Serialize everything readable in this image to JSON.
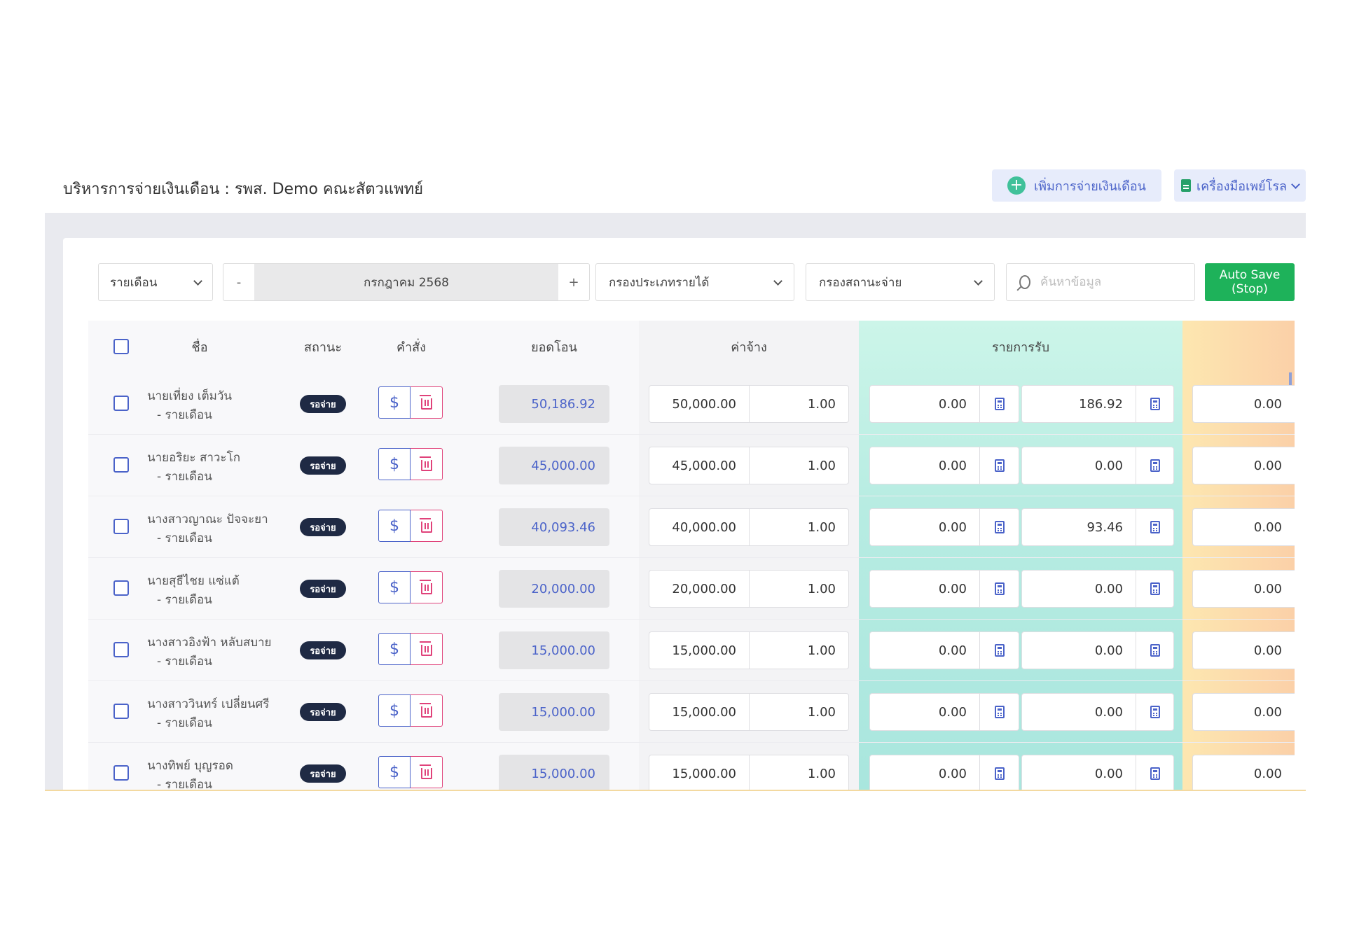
{
  "header": {
    "title": "บริหารการจ่ายเงินเดือน : รพส. Demo คณะสัตวแพทย์",
    "add_button": "เพิ่มการจ่ายเงินเดือน",
    "tools_button": "เครื่องมือเพย์โรล"
  },
  "filters": {
    "period": "รายเดือน",
    "month_minus": "-",
    "month": "กรกฎาคม 2568",
    "month_plus": "+",
    "income_type": "กรองประเภทรายได้",
    "pay_status": "กรองสถานะจ่าย",
    "search_placeholder": "ค้นหาข้อมูล",
    "autosave_line1": "Auto Save",
    "autosave_line2": "(Stop)"
  },
  "table": {
    "headers": {
      "name": "ชื่อ",
      "status": "สถานะ",
      "action": "คำสั่ง",
      "transfer": "ยอดโอน",
      "wage": "ค่าจ้าง",
      "income": "รายการรับ"
    },
    "rows": [
      {
        "name": "นายเที่ยง เต็มวัน",
        "period": "- รายเดือน",
        "status": "รอจ่าย",
        "transfer": "50,186.92",
        "wage": "50,000.00",
        "factor": "1.00",
        "income1": "0.00",
        "income2": "186.92",
        "deduct": "0.00"
      },
      {
        "name": "นายอริยะ สาวะโก",
        "period": "- รายเดือน",
        "status": "รอจ่าย",
        "transfer": "45,000.00",
        "wage": "45,000.00",
        "factor": "1.00",
        "income1": "0.00",
        "income2": "0.00",
        "deduct": "0.00"
      },
      {
        "name": "นางสาวญาณะ ปัจจะยา",
        "period": "- รายเดือน",
        "status": "รอจ่าย",
        "transfer": "40,093.46",
        "wage": "40,000.00",
        "factor": "1.00",
        "income1": "0.00",
        "income2": "93.46",
        "deduct": "0.00"
      },
      {
        "name": "นายสุธีไชย แซ่แต้",
        "period": "- รายเดือน",
        "status": "รอจ่าย",
        "transfer": "20,000.00",
        "wage": "20,000.00",
        "factor": "1.00",
        "income1": "0.00",
        "income2": "0.00",
        "deduct": "0.00"
      },
      {
        "name": "นางสาวอิงฟ้า หลับสบาย",
        "period": "- รายเดือน",
        "status": "รอจ่าย",
        "transfer": "15,000.00",
        "wage": "15,000.00",
        "factor": "1.00",
        "income1": "0.00",
        "income2": "0.00",
        "deduct": "0.00"
      },
      {
        "name": "นางสาววินทร์ เปลี่ยนศรี",
        "period": "- รายเดือน",
        "status": "รอจ่าย",
        "transfer": "15,000.00",
        "wage": "15,000.00",
        "factor": "1.00",
        "income1": "0.00",
        "income2": "0.00",
        "deduct": "0.00"
      },
      {
        "name": "นางทิพย์ บุญรอด",
        "period": "- รายเดือน",
        "status": "รอจ่าย",
        "transfer": "15,000.00",
        "wage": "15,000.00",
        "factor": "1.00",
        "income1": "0.00",
        "income2": "0.00",
        "deduct": "0.00"
      }
    ]
  },
  "icons": {
    "add": "plus-circle-icon",
    "tools": "document-icon",
    "search": "search-icon",
    "pay": "dollar-icon",
    "delete": "trash-icon",
    "calc": "calculator-icon"
  },
  "colors": {
    "accent": "#4b63c9",
    "success": "#1eb25a",
    "danger": "#e0427a",
    "badge": "#1f2a44"
  }
}
